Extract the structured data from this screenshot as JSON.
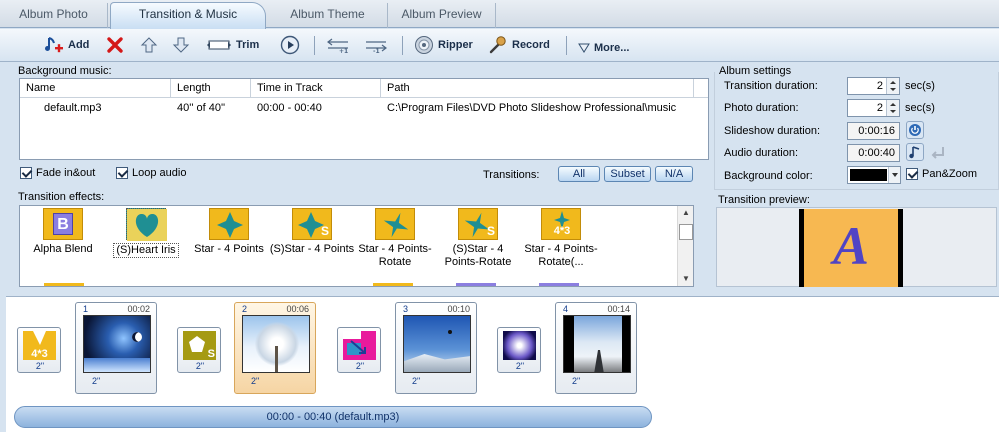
{
  "tabs": [
    {
      "label": "Album Photo"
    },
    {
      "label": "Transition & Music"
    },
    {
      "label": "Album Theme"
    },
    {
      "label": "Album Preview"
    }
  ],
  "toolbar": {
    "add": "Add",
    "trim": "Trim",
    "ripper": "Ripper",
    "record": "Record",
    "more": "More..."
  },
  "music": {
    "title": "Background music:",
    "columns": [
      "Name",
      "Length",
      "Time in Track",
      "Path"
    ],
    "rows": [
      {
        "name": "default.mp3",
        "length": "40'' of 40''",
        "time": "00:00 - 00:40",
        "path": "C:\\Program Files\\DVD Photo Slideshow Professional\\music"
      }
    ],
    "fade": "Fade in&out",
    "loop": "Loop audio",
    "transitions_label": "Transitions:",
    "btn_all": "All",
    "btn_subset": "Subset",
    "btn_na": "N/A"
  },
  "effects": {
    "title": "Transition effects:",
    "items": [
      {
        "label": "Alpha Blend",
        "glyph": "B"
      },
      {
        "label": "(S)Heart Iris",
        "glyph": ""
      },
      {
        "label": "Star - 4 Points",
        "glyph": ""
      },
      {
        "label": "(S)Star - 4 Points",
        "glyph": "S"
      },
      {
        "label": "Star - 4 Points-Rotate",
        "glyph": ""
      },
      {
        "label": "(S)Star - 4 Points-Rotate",
        "glyph": "S"
      },
      {
        "label": "Star - 4 Points-Rotate(...",
        "glyph": "4*3"
      }
    ]
  },
  "settings": {
    "title": "Album settings",
    "transition_duration_label": "Transition duration:",
    "transition_duration_value": "2",
    "photo_duration_label": "Photo duration:",
    "photo_duration_value": "2",
    "unit": "sec(s)",
    "slideshow_duration_label": "Slideshow duration:",
    "slideshow_duration_value": "0:00:16",
    "audio_duration_label": "Audio duration:",
    "audio_duration_value": "0:00:40",
    "background_color_label": "Background color:",
    "background_color": "#000000",
    "panzoom": "Pan&Zoom"
  },
  "preview": {
    "title": "Transition preview:",
    "letter": "A"
  },
  "storyboard": {
    "slides": [
      {
        "num": "1",
        "time": "00:02",
        "dur": "2\""
      },
      {
        "num": "2",
        "time": "00:06",
        "dur": "2\""
      },
      {
        "num": "3",
        "time": "00:10",
        "dur": "2\""
      },
      {
        "num": "4",
        "time": "00:14",
        "dur": "2\""
      }
    ],
    "transitions": [
      {
        "dur": "2\"",
        "glyph": "4*3"
      },
      {
        "dur": "2\"",
        "glyph": "S"
      },
      {
        "dur": "2\""
      },
      {
        "dur": "2\""
      }
    ],
    "audio_bar": "00:00 - 00:40 (default.mp3)"
  }
}
